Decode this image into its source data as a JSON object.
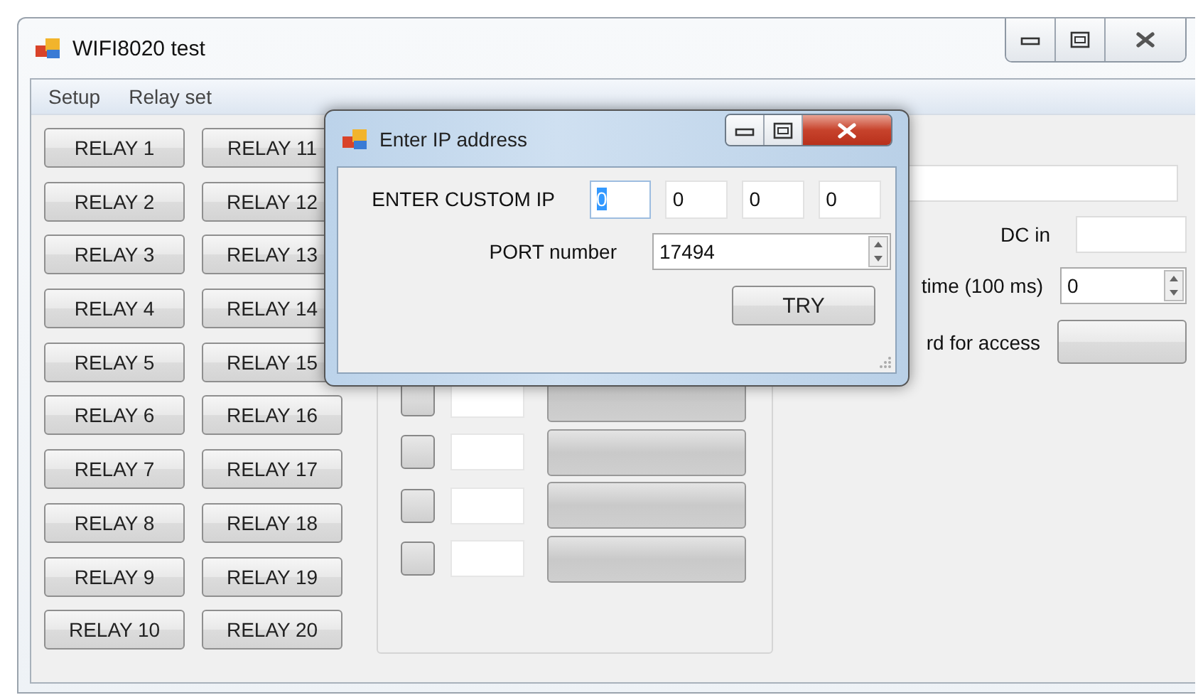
{
  "window": {
    "title": "WIFI8020 test"
  },
  "menu": [
    "Setup",
    "Relay set"
  ],
  "relay_columns": [
    [
      "RELAY 1",
      "RELAY 2",
      "RELAY 3",
      "RELAY 4",
      "RELAY 5",
      "RELAY 6",
      "RELAY 7",
      "RELAY 8",
      "RELAY 9",
      "RELAY 10"
    ],
    [
      "RELAY 11",
      "RELAY 12",
      "RELAY 13",
      "RELAY 14",
      "RELAY 15",
      "RELAY 16",
      "RELAY 17",
      "RELAY 18",
      "RELAY 19",
      "RELAY 20"
    ]
  ],
  "channel_rows": [
    {
      "checked": false
    },
    {
      "checked": false
    },
    {
      "checked": false
    },
    {
      "checked": false
    }
  ],
  "right_panel": {
    "dc_label": "DC in",
    "time_label": "time (100 ms)",
    "time_value": "0",
    "access_label": "rd for access"
  },
  "dialog": {
    "title": "Enter IP address",
    "ip_label": "ENTER CUSTOM IP",
    "ip_octets": [
      {
        "value": "0",
        "selected": true
      },
      {
        "value": "0",
        "selected": false
      },
      {
        "value": "0",
        "selected": false
      },
      {
        "value": "0",
        "selected": false
      }
    ],
    "port_label": "PORT number",
    "port_value": "17494",
    "button": "TRY"
  }
}
